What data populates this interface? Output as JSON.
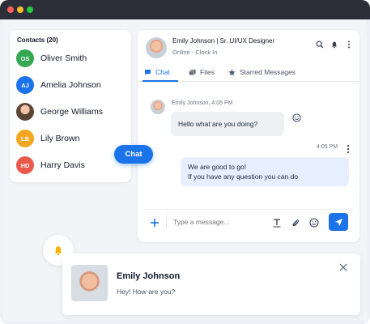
{
  "colors": {
    "accent": "#1a73e8",
    "titlebar": "#2c2f3a",
    "dot_red": "#ff5f56",
    "dot_yellow": "#ffbd2e",
    "dot_green": "#27c93f"
  },
  "contacts": {
    "title": "Contacts (20)",
    "items": [
      {
        "initials": "OS",
        "name": "Oliver Smith",
        "color": "#34a853"
      },
      {
        "initials": "AJ",
        "name": "Amelia Johnson",
        "color": "#1a73e8"
      },
      {
        "initials": "",
        "name": "George Williams",
        "color": ""
      },
      {
        "initials": "LB",
        "name": "Lily Brown",
        "color": "#f5a623"
      },
      {
        "initials": "HD",
        "name": "Harry Davis",
        "color": "#ea5a4a"
      }
    ]
  },
  "floating_chat_label": "Chat",
  "chat": {
    "header": {
      "name": "Emily Johnson | Sr. UI/UX Designer",
      "status": "Online - Clock In"
    },
    "tabs": [
      {
        "label": "Chat",
        "icon": "chat-icon"
      },
      {
        "label": "Files",
        "icon": "files-icon"
      },
      {
        "label": "Starred Messages",
        "icon": "star-icon"
      }
    ],
    "messages": {
      "incoming_meta": "Emily Johnson, 4:05 PM",
      "incoming_text": "Hello what are you doing?",
      "outgoing_time": "4:05 PM",
      "outgoing_line1": "We are good to go!",
      "outgoing_line2": "If you have any question you can do"
    },
    "composer": {
      "placeholder": "Type a message..."
    }
  },
  "notification": {
    "name": "Emily Johnson",
    "text": "Hey! How are you?"
  }
}
